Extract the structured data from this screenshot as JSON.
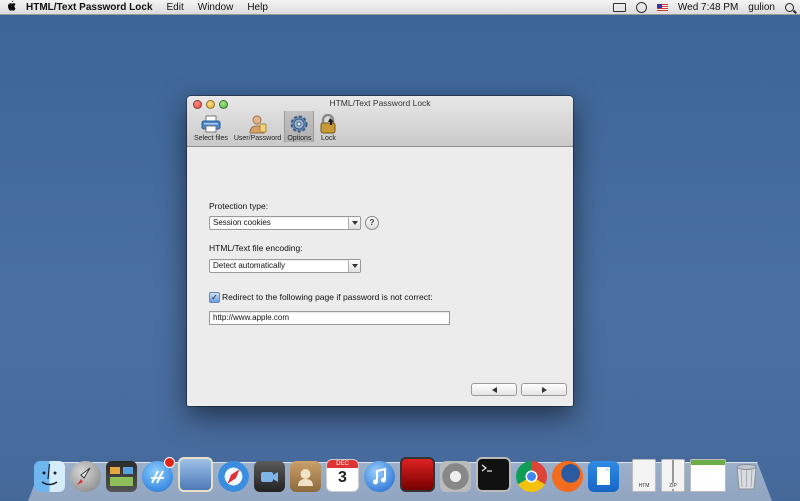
{
  "menubar": {
    "app_name": "HTML/Text Password Lock",
    "menus": [
      "Edit",
      "Window",
      "Help"
    ],
    "clock": "Wed 7:48 PM",
    "user": "gulion"
  },
  "window": {
    "title": "HTML/Text Password Lock",
    "toolbar": [
      {
        "label": "Select files",
        "icon": "printer-icon"
      },
      {
        "label": "User/Password",
        "icon": "user-key-icon"
      },
      {
        "label": "Options",
        "icon": "gear-icon",
        "selected": true
      },
      {
        "label": "Lock",
        "icon": "lock-icon"
      }
    ],
    "protection_type_label": "Protection type:",
    "protection_type_value": "Session cookies",
    "help_glyph": "?",
    "encoding_label": "HTML/Text file encoding:",
    "encoding_value": "Detect automatically",
    "redirect_checked": true,
    "redirect_label": "Redirect to the following page if password is not correct:",
    "redirect_url": "http://www.apple.com"
  },
  "dock": {
    "apps": [
      "finder-icon",
      "launchpad-icon",
      "mission-control-icon",
      "app-store-icon",
      "preview-icon",
      "safari-icon",
      "facetime-icon",
      "contacts-icon",
      "calendar-icon",
      "itunes-icon",
      "photo-booth-icon",
      "system-preferences-icon",
      "terminal-icon",
      "chrome-icon",
      "firefox-icon",
      "document-app-icon"
    ],
    "calendar_month": "DEC",
    "calendar_day": "3",
    "stack_items": [
      {
        "icon": "htm-file-icon",
        "label": "HTM"
      },
      {
        "icon": "zip-file-icon",
        "label": "ZIP"
      },
      {
        "icon": "web-page-icon",
        "label": ""
      },
      {
        "icon": "trash-icon",
        "label": ""
      }
    ]
  },
  "colors": {
    "desktop": "#3f6699",
    "accent": "#3b73d6"
  }
}
